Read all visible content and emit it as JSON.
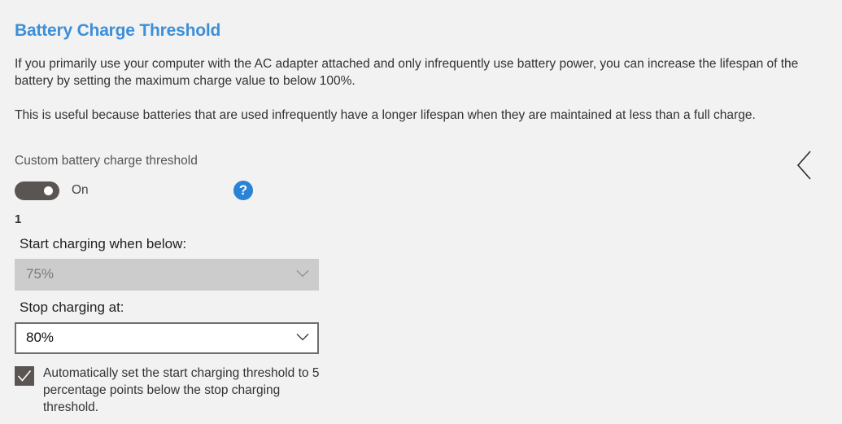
{
  "section": {
    "title": "Battery Charge Threshold",
    "paragraph1": "If you primarily use your computer with the AC adapter attached and only infrequently use battery power, you can increase the lifespan of the battery by setting the maximum charge value to below 100%.",
    "paragraph2": "This is useful because batteries that are used infrequently have a longer lifespan when they are maintained at less than a full charge."
  },
  "custom_threshold": {
    "label": "Custom battery charge threshold",
    "toggle_state": "On",
    "toggle_on": true,
    "help_symbol": "?",
    "help_icon": "question-circle-icon"
  },
  "profile": {
    "number": "1",
    "start_label": "Start charging when below:",
    "start_value": "75%",
    "start_enabled": false,
    "stop_label": "Stop charging at:",
    "stop_value": "80%",
    "stop_enabled": true
  },
  "auto_set": {
    "checked": true,
    "label": "Automatically set the start charging threshold to 5 percentage points below the stop charging threshold."
  },
  "collapse_icon": "chevron-left-icon",
  "colors": {
    "title": "#3d8fd8",
    "toggle_bg": "#5a5553",
    "help_bg": "#2a83d4",
    "background": "#f2f2f2",
    "disabled_select_bg": "#cccccc"
  }
}
